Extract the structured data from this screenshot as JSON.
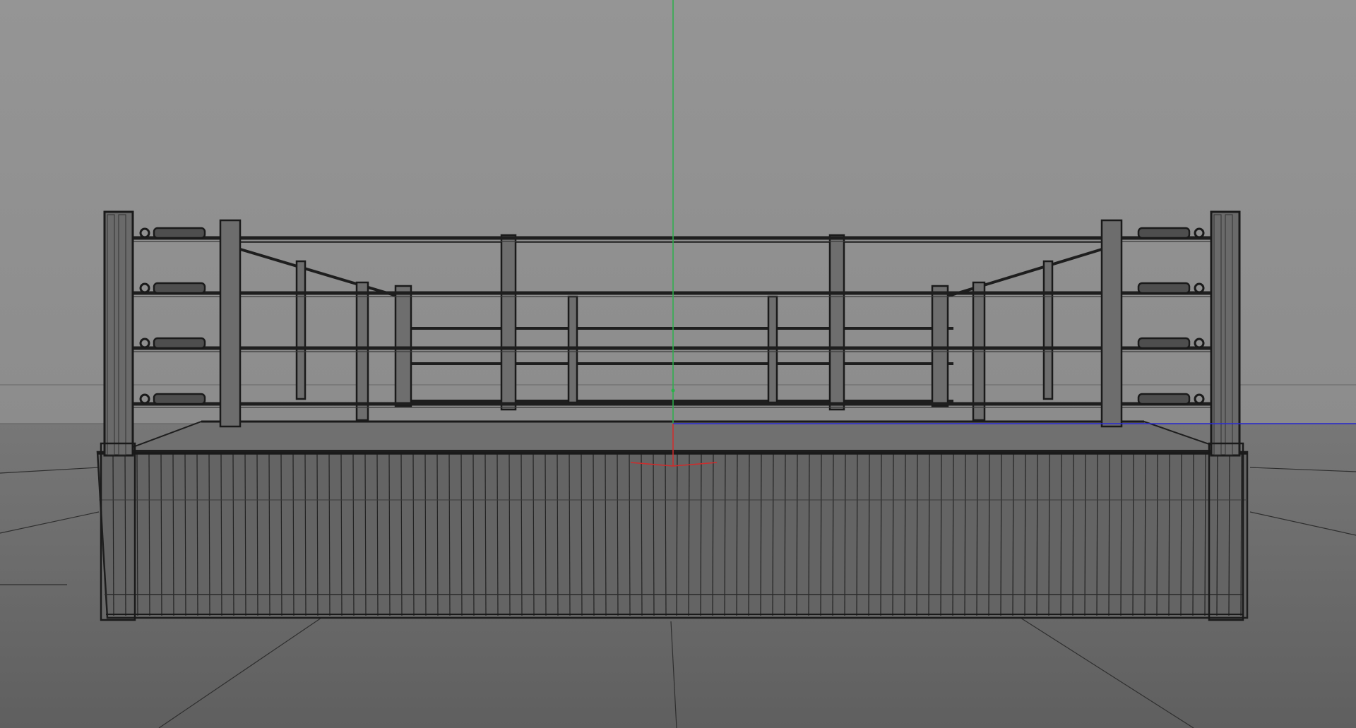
{
  "viewport": {
    "view": "perspective",
    "scene_object": "boxing ring",
    "display_mode": "wireframe",
    "colors": {
      "background_top": "#939393",
      "background_horizon": "#848484",
      "ground": "#6a6a6a",
      "grid_line": "#2e2e2e",
      "wire": "#1e1e1e",
      "apron_fill": "#646464",
      "canvas_fill": "#6f6f6f",
      "axis_x": "#d22a2a",
      "axis_y": "#2bb04a",
      "axis_z": "#2a2ad2"
    }
  }
}
